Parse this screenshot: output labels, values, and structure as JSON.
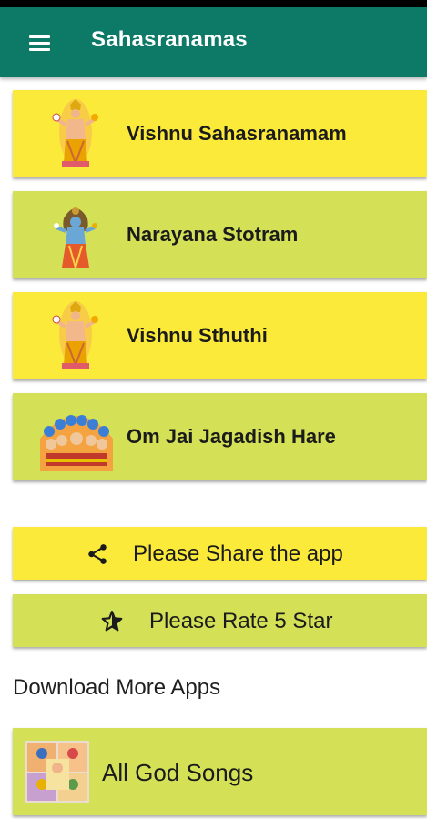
{
  "appbar": {
    "title": "Sahasranamas",
    "menu_icon": "hamburger-menu-icon",
    "background": "#0d7a68"
  },
  "items": [
    {
      "label": "Vishnu Sahasranamam",
      "icon": "vishnu-image",
      "color": "#fbea3a"
    },
    {
      "label": "Narayana Stotram",
      "icon": "narayana-image",
      "color": "#d4e157"
    },
    {
      "label": "Vishnu Sthuthi",
      "icon": "vishnu-image",
      "color": "#fbea3a"
    },
    {
      "label": "Om Jai Jagadish Hare",
      "icon": "vishwaroopa-image",
      "color": "#d4e157"
    }
  ],
  "actions": {
    "share": {
      "label": "Please Share the app",
      "icon": "share-icon",
      "color": "#fbea3a"
    },
    "rate": {
      "label": "Please Rate 5 Star",
      "icon": "star-icon",
      "color": "#d4e157"
    }
  },
  "more_apps": {
    "heading": "Download More Apps",
    "apps": [
      {
        "label": "All God Songs",
        "icon": "gods-collage-image",
        "color": "#d4e157"
      }
    ]
  }
}
